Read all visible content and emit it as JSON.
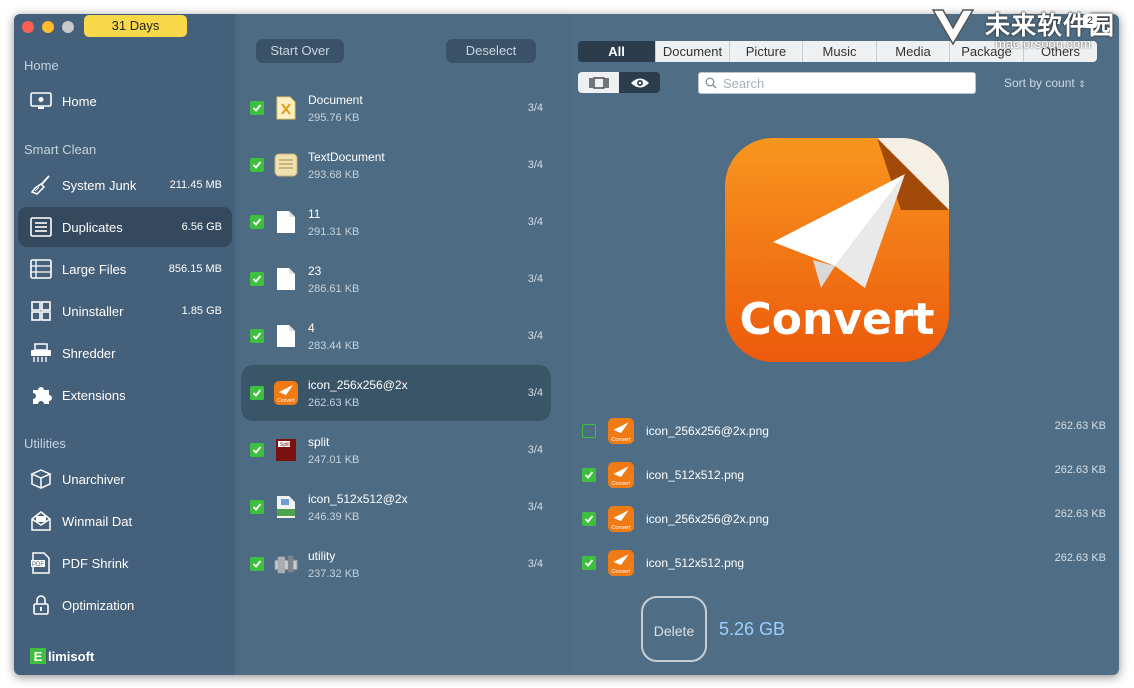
{
  "trial": {
    "days_label": "31 Days"
  },
  "sidebar": {
    "sections": {
      "home": "Home",
      "smart_clean": "Smart Clean",
      "utilities": "Utilities"
    },
    "items": [
      {
        "label": "Home",
        "size": ""
      },
      {
        "label": "System Junk",
        "size": "211.45 MB"
      },
      {
        "label": "Duplicates",
        "size": "6.56 GB"
      },
      {
        "label": "Large Files",
        "size": "856.15 MB"
      },
      {
        "label": "Uninstaller",
        "size": "1.85 GB"
      },
      {
        "label": "Shredder",
        "size": ""
      },
      {
        "label": "Extensions",
        "size": ""
      },
      {
        "label": "Unarchiver",
        "size": ""
      },
      {
        "label": "Winmail Dat",
        "size": ""
      },
      {
        "label": "PDF Shrink",
        "size": ""
      },
      {
        "label": "Optimization",
        "size": ""
      }
    ],
    "active_item": "Duplicates",
    "brand": "limisoft",
    "brand_mark": "E"
  },
  "middle": {
    "start_over_label": "Start Over",
    "deselect_label": "Deselect",
    "files": [
      {
        "name": "Document",
        "size": "295.76 KB",
        "count": "3/4",
        "icon": "document-icon",
        "checked": true
      },
      {
        "name": "TextDocument",
        "size": "293.68 KB",
        "count": "3/4",
        "icon": "text-document-icon",
        "checked": true
      },
      {
        "name": "11",
        "size": "291.31 KB",
        "count": "3/4",
        "icon": "blank-file-icon",
        "checked": true
      },
      {
        "name": "23",
        "size": "286.61 KB",
        "count": "3/4",
        "icon": "blank-file-icon",
        "checked": true
      },
      {
        "name": "4",
        "size": "283.44 KB",
        "count": "3/4",
        "icon": "blank-file-icon",
        "checked": true
      },
      {
        "name": "icon_256x256@2x",
        "size": "262.63 KB",
        "count": "3/4",
        "icon": "convert-app-icon",
        "checked": true
      },
      {
        "name": "split",
        "size": "247.01 KB",
        "count": "3/4",
        "icon": "split-pdf-icon",
        "checked": true
      },
      {
        "name": "icon_512x512@2x",
        "size": "246.39 KB",
        "count": "3/4",
        "icon": "script-file-icon",
        "checked": true
      },
      {
        "name": "utility",
        "size": "237.32 KB",
        "count": "3/4",
        "icon": "utility-icon",
        "checked": true
      }
    ],
    "active_file": "icon_256x256@2x"
  },
  "right": {
    "tabs": [
      "All",
      "Document",
      "Picture",
      "Music",
      "Media",
      "Package",
      "Others"
    ],
    "active_tab": "All",
    "search_placeholder": "Search",
    "sort_label": "Sort by count",
    "preview_text": "Convert",
    "details": [
      {
        "name": "icon_256x256@2x.png",
        "size": "262.63 KB",
        "checked": false
      },
      {
        "name": "icon_512x512.png",
        "size": "262.63 KB",
        "checked": true
      },
      {
        "name": "icon_256x256@2x.png",
        "size": "262.63 KB",
        "checked": true
      },
      {
        "name": "icon_512x512.png",
        "size": "262.63 KB",
        "checked": true
      }
    ],
    "delete_label": "Delete",
    "total_size": "5.26 GB"
  },
  "watermark": {
    "title": "未来软件园",
    "subtitle": "mac.orsoon.com",
    "badge": "2"
  },
  "colors": {
    "sidebar_bg": "#44607a",
    "middle_bg": "#4d6c84",
    "right_bg": "#4f6e86",
    "check_green": "#3fbf3f",
    "trial_badge": "#f8d849",
    "convert_orange": "#f06a10",
    "total_size_blue": "#9fcfff"
  }
}
